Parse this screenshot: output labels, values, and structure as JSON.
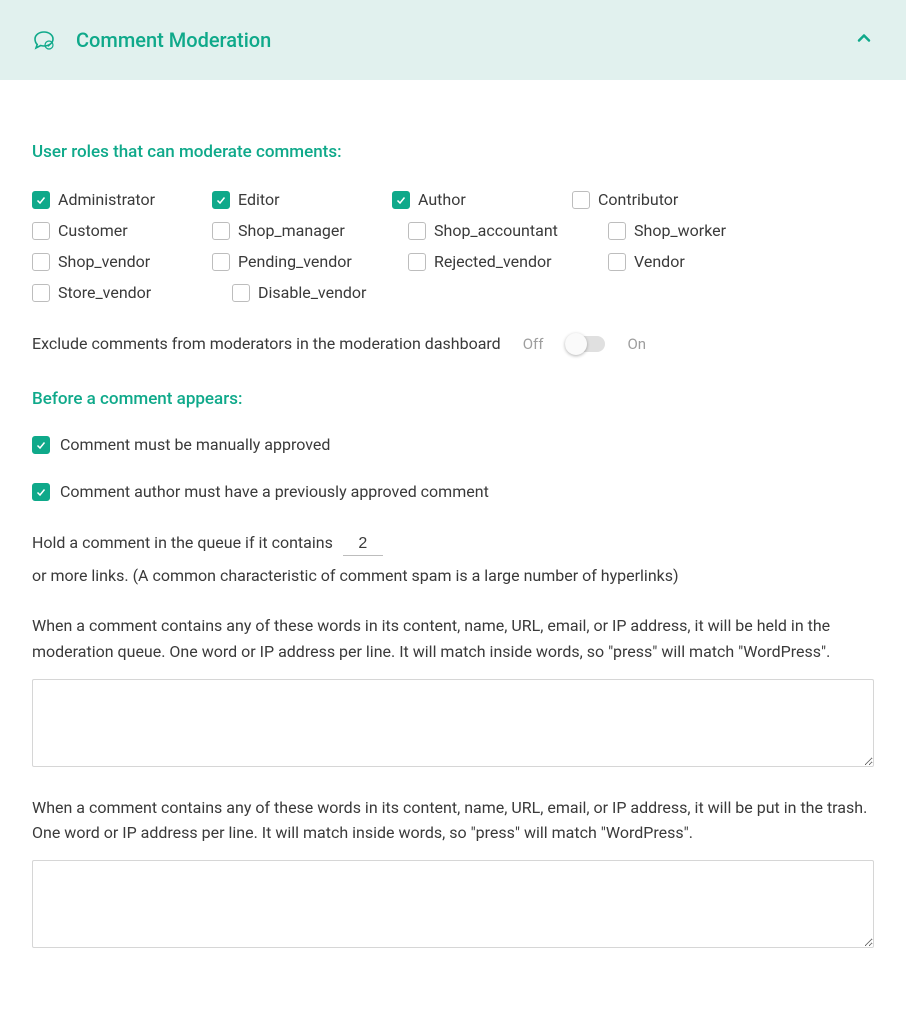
{
  "header": {
    "title": "Comment Moderation"
  },
  "sections": {
    "roles_heading": "User roles that can moderate comments:",
    "before_heading": "Before a comment appears:"
  },
  "roles": [
    {
      "label": "Administrator",
      "checked": true
    },
    {
      "label": "Editor",
      "checked": true
    },
    {
      "label": "Author",
      "checked": true
    },
    {
      "label": "Contributor",
      "checked": false
    },
    {
      "label": "Customer",
      "checked": false
    },
    {
      "label": "Shop_manager",
      "checked": false
    },
    {
      "label": "Shop_accountant",
      "checked": false
    },
    {
      "label": "Shop_worker",
      "checked": false
    },
    {
      "label": "Shop_vendor",
      "checked": false
    },
    {
      "label": "Pending_vendor",
      "checked": false
    },
    {
      "label": "Rejected_vendor",
      "checked": false
    },
    {
      "label": "Vendor",
      "checked": false
    },
    {
      "label": "Store_vendor",
      "checked": false
    },
    {
      "label": "Disable_vendor",
      "checked": false
    }
  ],
  "exclude_toggle": {
    "label": "Exclude comments from moderators in the moderation dashboard",
    "off": "Off",
    "on": "On",
    "value": false
  },
  "before_checks": {
    "manual_approve": {
      "label": "Comment must be manually approved",
      "checked": true
    },
    "prev_approved": {
      "label": "Comment author must have a previously approved comment",
      "checked": true
    }
  },
  "links_rule": {
    "prefix": "Hold a comment in the queue if it contains",
    "value": "2",
    "suffix": "or more links. (A common characteristic of comment spam is a large number of hyperlinks)"
  },
  "moderation_words": {
    "desc": "When a comment contains any of these words in its content, name, URL, email, or IP address, it will be held in the moderation queue. One word or IP address per line. It will match inside words, so \"press\" will match \"WordPress\".",
    "value": ""
  },
  "blacklist_words": {
    "desc": "When a comment contains any of these words in its content, name, URL, email, or IP address, it will be put in the trash. One word or IP address per line. It will match inside words, so \"press\" will match \"WordPress\".",
    "value": ""
  }
}
